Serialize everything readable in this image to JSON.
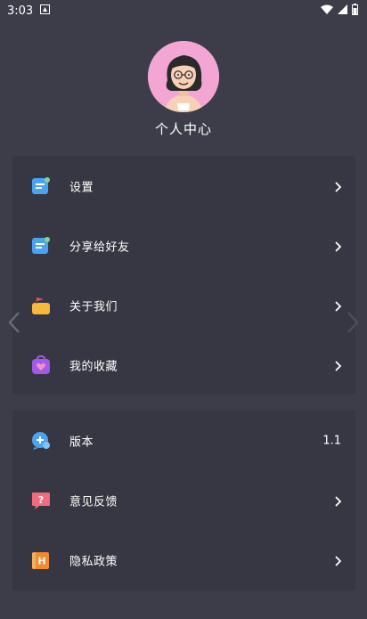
{
  "status_bar": {
    "time": "3:03"
  },
  "profile": {
    "title": "个人中心"
  },
  "menu_group_1": [
    {
      "label": "设置",
      "icon": "settings-icon"
    },
    {
      "label": "分享给好友",
      "icon": "share-icon"
    },
    {
      "label": "关于我们",
      "icon": "about-icon"
    },
    {
      "label": "我的收藏",
      "icon": "favorites-icon"
    }
  ],
  "menu_group_2": [
    {
      "label": "版本",
      "icon": "version-icon",
      "value": "1.1"
    },
    {
      "label": "意见反馈",
      "icon": "feedback-icon"
    },
    {
      "label": "隐私政策",
      "icon": "privacy-icon"
    }
  ],
  "colors": {
    "background": "#3d3d4a",
    "card": "#373743",
    "text": "#ffffff",
    "avatar_bg": "#f3a6d3"
  }
}
